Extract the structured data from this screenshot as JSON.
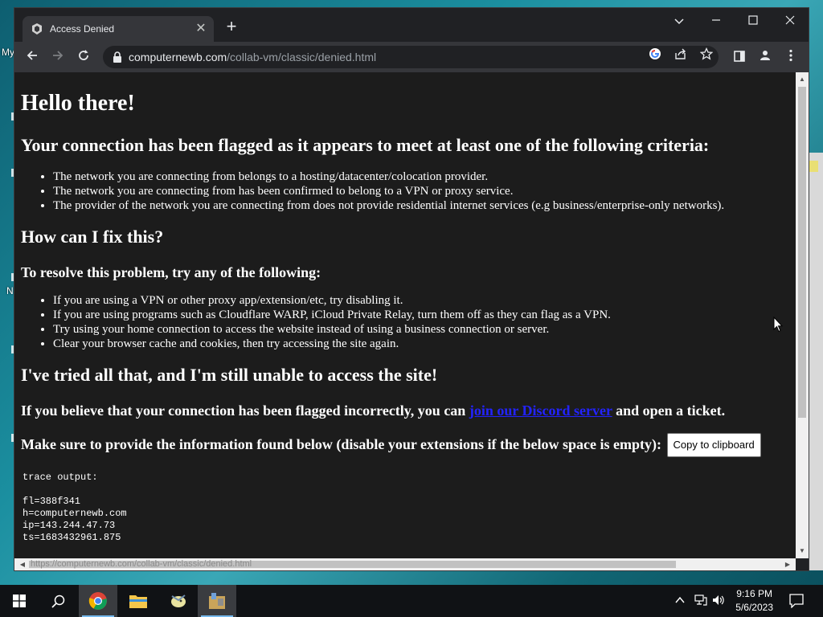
{
  "desktop": {
    "labels": [
      "My",
      "N"
    ]
  },
  "browser": {
    "tab_title": "Access Denied",
    "tab_close": "✕",
    "new_tab": "+",
    "window_controls": {
      "dropdown": "⌄",
      "minimize": "—",
      "maximize": "☐",
      "close": "✕"
    },
    "url_host": "computernewb.com",
    "url_path": "/collab-vm/classic/denied.html",
    "status_url": "https://computernewb.com/collab-vm/classic/denied.html"
  },
  "page": {
    "heading": "Hello there!",
    "flag_heading": "Your connection has been flagged as it appears to meet at least one of the following criteria:",
    "criteria": [
      "The network you are connecting from belongs to a hosting/datacenter/colocation provider.",
      "The network you are connecting from has been confirmed to belong to a VPN or proxy service.",
      "The provider of the network you are connecting from does not provide residential internet services (e.g business/enterprise-only networks)."
    ],
    "fix_heading": "How can I fix this?",
    "resolve_heading": "To resolve this problem, try any of the following:",
    "fixes": [
      "If you are using a VPN or other proxy app/extension/etc, try disabling it.",
      "If you are using programs such as Cloudflare WARP, iCloud Private Relay, turn them off as they can flag as a VPN.",
      "Try using your home connection to access the website instead of using a business connection or server.",
      "Clear your browser cache and cookies, then try accessing the site again."
    ],
    "tried_heading": "I've tried all that, and I'm still unable to access the site!",
    "believe_text_before": "If you believe that your connection has been flagged incorrectly, you can ",
    "discord_link": "join our Discord server",
    "believe_text_after": " and open a ticket.",
    "provide_text": "Make sure to provide the information found below (disable your extensions if the below space is empty):",
    "copy_button": "Copy to clipboard",
    "trace": "trace output:\n\nfl=388f341\nh=computernewb.com\nip=143.244.47.73\nts=1683432961.875"
  },
  "taskbar": {
    "time": "9:16 PM",
    "date": "5/6/2023"
  }
}
